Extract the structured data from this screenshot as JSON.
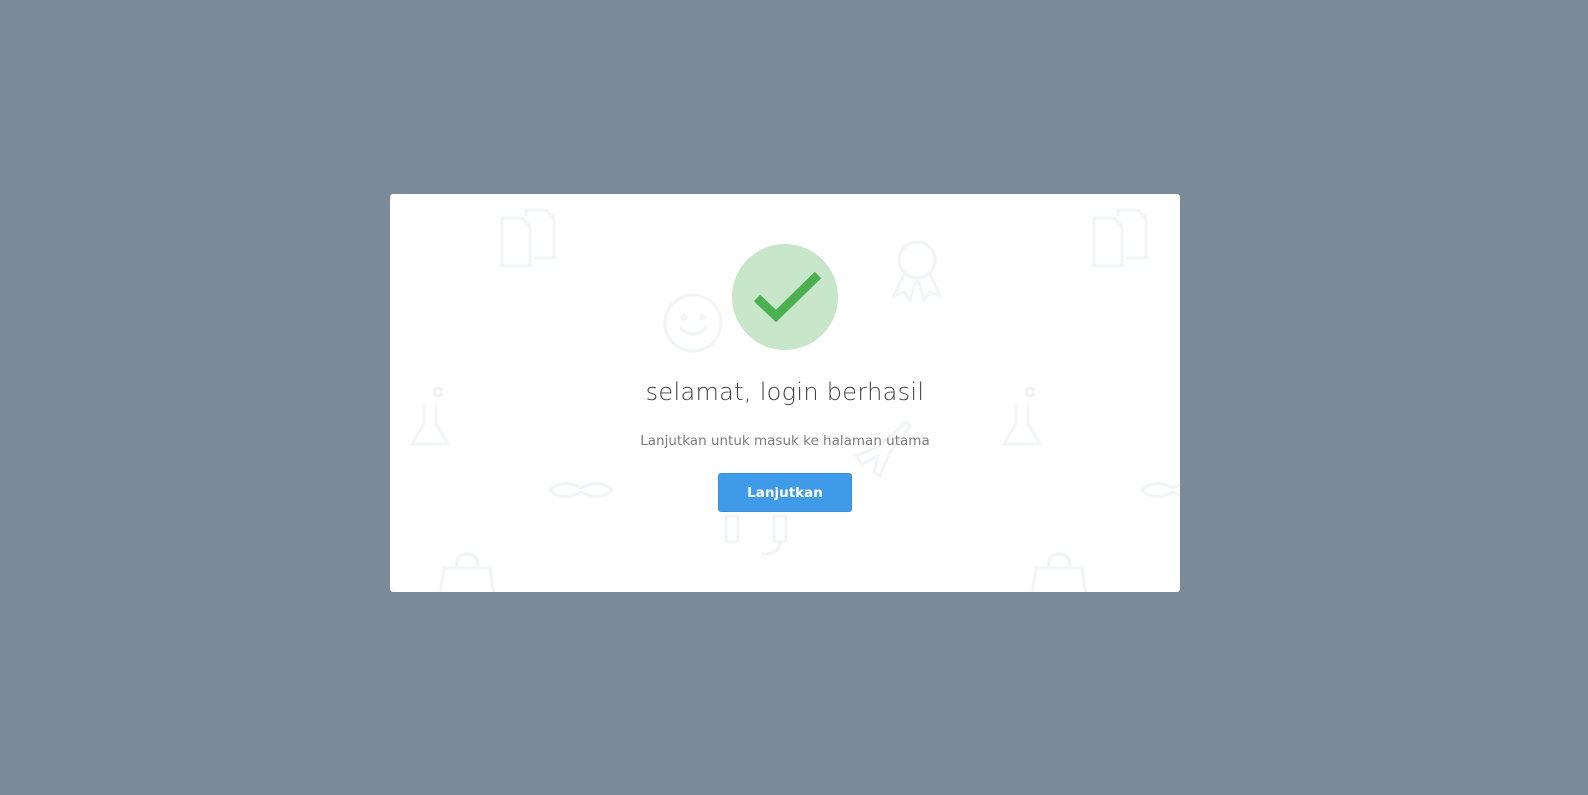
{
  "dialog": {
    "title": "selamat, login berhasil",
    "message": "Lanjutkan untuk masuk ke halaman utama",
    "confirm_label": "Lanjutkan",
    "status_icon": "success-checkmark-icon"
  },
  "colors": {
    "backdrop": "#7a8a99",
    "modal_background": "#ffffff",
    "success_circle": "#c8e6c9",
    "success_check": "#4caf50",
    "button_background": "#3f9ae8",
    "title_text": "#3f3f3f",
    "message_text": "#7c7c7c"
  }
}
